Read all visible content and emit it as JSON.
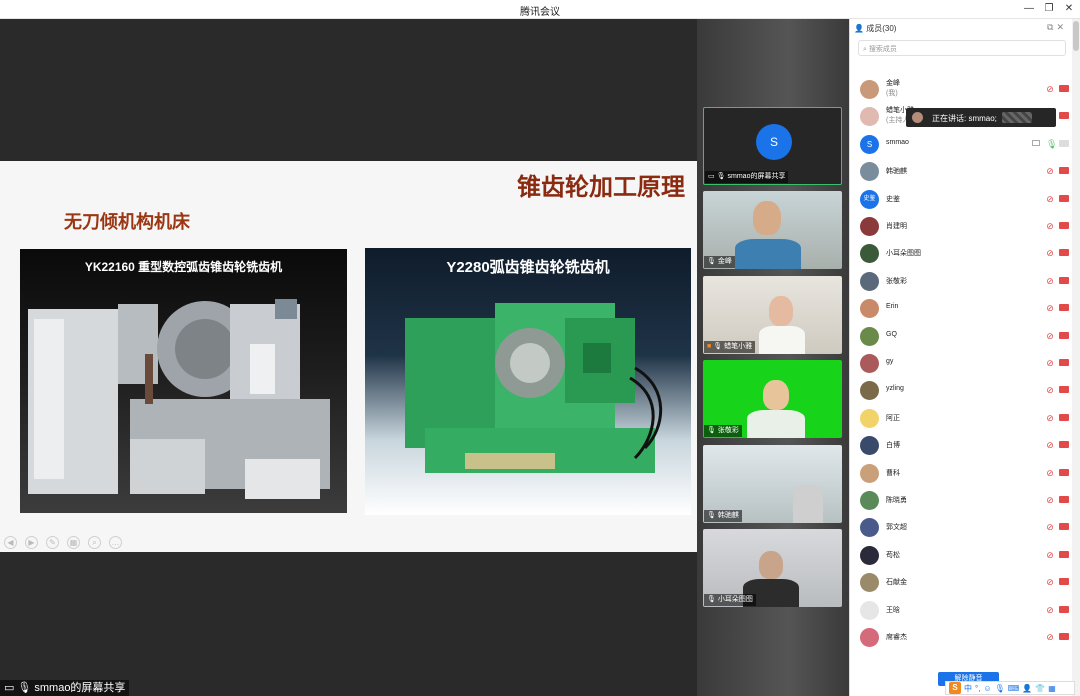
{
  "window": {
    "title": "腾讯会议"
  },
  "slide": {
    "title": "锥齿轮加工原理",
    "subtitle": "无刀倾机构机床",
    "photo_left_caption": "YK22160 重型数控弧齿锥齿轮铣齿机",
    "photo_right_caption": "Y2280弧齿锥齿轮铣齿机"
  },
  "share_label": "smmao的屏幕共享",
  "videos": [
    {
      "label": "smmao的屏幕共享",
      "avatar_letter": "S"
    },
    {
      "label": "金峰"
    },
    {
      "label": "蜡笔小雅"
    },
    {
      "label": "张敬彩"
    },
    {
      "label": "韩驰麒"
    },
    {
      "label": "小耳朵图图"
    }
  ],
  "panel": {
    "title": "成员(30)",
    "search_placeholder": "搜索成员",
    "speaking": "正在讲话: smmao;",
    "unmute_button": "解除静音",
    "members": [
      {
        "name": "金峰",
        "sub": "(我)",
        "avatar": "#c99a7a"
      },
      {
        "name": "蜡笔小雅",
        "sub": "(主持人)",
        "avatar": "#e0b9b0"
      },
      {
        "name": "smmao",
        "avatar": "#1a73e8",
        "letter": "S"
      },
      {
        "name": "韩驰麒",
        "avatar": "#7a8d9c"
      },
      {
        "name": "史鉴",
        "avatar": "#1a73e8",
        "letter": "史鉴"
      },
      {
        "name": "肖建明",
        "avatar": "#8a3a3a"
      },
      {
        "name": "小耳朵图图",
        "avatar": "#3a5a3a"
      },
      {
        "name": "张敬彩",
        "avatar": "#5a6a7a"
      },
      {
        "name": "Erin",
        "avatar": "#c98a6a"
      },
      {
        "name": "GQ",
        "avatar": "#6a8a4a"
      },
      {
        "name": "gy",
        "avatar": "#aa5a5a"
      },
      {
        "name": "yzling",
        "avatar": "#7a6a4a"
      },
      {
        "name": "阿正",
        "avatar": "#f2d36a"
      },
      {
        "name": "白博",
        "avatar": "#3a4a6a"
      },
      {
        "name": "曹科",
        "avatar": "#caa07a"
      },
      {
        "name": "陈晓勇",
        "avatar": "#5a8a5a"
      },
      {
        "name": "郭文超",
        "avatar": "#4a5a8a"
      },
      {
        "name": "苟松",
        "avatar": "#2a2a3a"
      },
      {
        "name": "石献金",
        "avatar": "#9a8a6a"
      },
      {
        "name": "王晗",
        "avatar": "#e6e6e6"
      },
      {
        "name": "席睿杰",
        "avatar": "#d46a7a"
      }
    ]
  }
}
